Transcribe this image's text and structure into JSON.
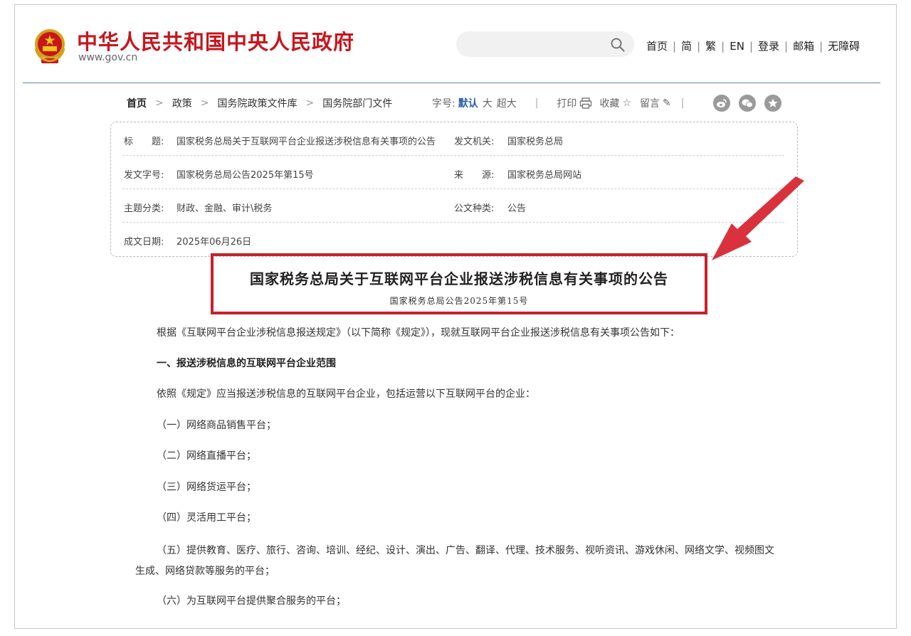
{
  "header": {
    "site_title": "中华人民共和国中央人民政府",
    "site_url": "www.gov.cn",
    "search_placeholder": "",
    "nav": [
      "首页",
      "简",
      "繁",
      "EN",
      "登录",
      "邮箱",
      "无障碍"
    ]
  },
  "breadcrumb": {
    "items": [
      "首页",
      "政策",
      "国务院政策文件库",
      "国务院部门文件"
    ]
  },
  "toolbar": {
    "font_size_label": "字号:",
    "font_default": "默认",
    "font_large": "大",
    "font_xlarge": "超大",
    "print": "打印",
    "favorite": "收藏",
    "comment": "留言"
  },
  "meta": {
    "title_label": "标　　题:",
    "title_value": "国家税务总局关于互联网平台企业报送涉税信息有关事项的公告",
    "issuer_label": "发文机关:",
    "issuer_value": "国家税务总局",
    "doc_no_label": "发文字号:",
    "doc_no_value": "国家税务总局公告2025年第15号",
    "source_label": "来　　源:",
    "source_value": "国家税务总局网站",
    "topic_label": "主题分类:",
    "topic_value": "财政、金融、审计\\税务",
    "type_label": "公文种类:",
    "type_value": "公告",
    "date_label": "成文日期:",
    "date_value": "2025年06月26日"
  },
  "document": {
    "title": "国家税务总局关于互联网平台企业报送涉税信息有关事项的公告",
    "subtitle": "国家税务总局公告2025年第15号",
    "intro": "根据《互联网平台企业涉税信息报送规定》（以下简称《规定》），现就互联网平台企业报送涉税信息有关事项公告如下：",
    "section1_heading": "一、报送涉税信息的互联网平台企业范围",
    "section1_intro": "依照《规定》应当报送涉税信息的互联网平台企业，包括运营以下互联网平台的企业：",
    "items": [
      "（一）网络商品销售平台；",
      "（二）网络直播平台；",
      "（三）网络货运平台；",
      "（四）灵活用工平台；",
      "（五）提供教育、医疗、旅行、咨询、培训、经纪、设计、演出、广告、翻译、代理、技术服务、视听资讯、游戏休闲、网络文学、视频图文生成、网络贷款等服务的平台；",
      "（六）为互联网平台提供聚合服务的平台；"
    ]
  },
  "colors": {
    "brand_red": "#c7161e",
    "highlight_red": "#c8202b",
    "active_blue": "#2a5fa8"
  }
}
